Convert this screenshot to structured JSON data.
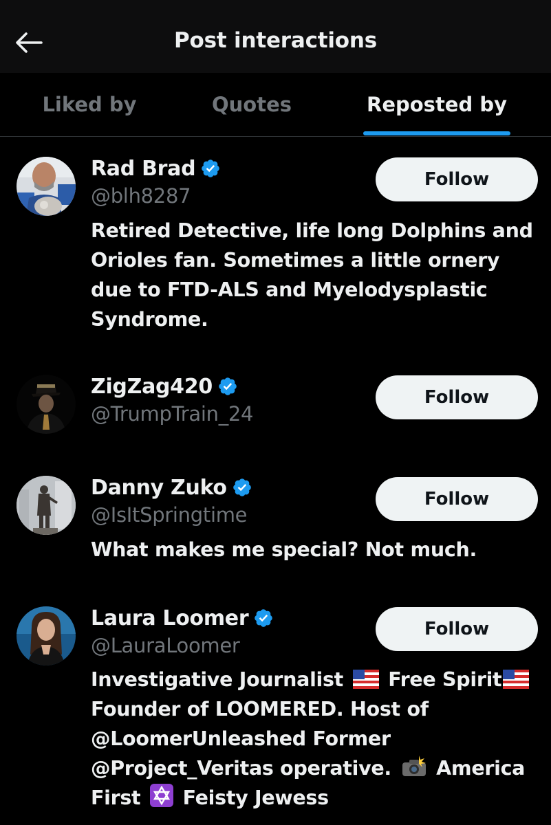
{
  "header": {
    "title": "Post interactions",
    "back_icon": "arrow-left-icon"
  },
  "tabs": [
    {
      "label": "Liked by",
      "active": false
    },
    {
      "label": "Quotes",
      "active": false
    },
    {
      "label": "Reposted by",
      "active": true
    }
  ],
  "colors": {
    "accent": "#1d9bf0",
    "background": "#000000",
    "secondary_text": "#71767b",
    "follow_button_bg": "#eff3f4"
  },
  "users": [
    {
      "name": "Rad Brad",
      "handle": "@blh8287",
      "verified": true,
      "follow_label": "Follow",
      "bio_lines": [
        "Retired Detective, life long Dolphins and",
        "Orioles fan. Sometimes a little ornery",
        "due to FTD-ALS and Myelodysplastic",
        "Syndrome."
      ]
    },
    {
      "name": "ZigZag420",
      "handle": "@TrumpTrain_24",
      "verified": true,
      "follow_label": "Follow",
      "bio_lines": []
    },
    {
      "name": "Danny Zuko",
      "handle": "@IsItSpringtime",
      "verified": true,
      "follow_label": "Follow",
      "bio_lines": [
        "What makes me special? Not much."
      ]
    },
    {
      "name": "Laura Loomer",
      "handle": "@LauraLoomer",
      "verified": true,
      "follow_label": "Follow",
      "bio": {
        "line1_a": "Investigative Journalist",
        "line1_b": "Free Spirit",
        "line2": "Founder of LOOMERED. Host of",
        "line3": "@LoomerUnleashed Former",
        "line4_a": "@Project_Veritas operative.",
        "line4_b": "America",
        "line5_a": "First",
        "line5_b": "Feisty Jewess"
      },
      "bio_emoji": [
        "us-flag-icon",
        "us-flag-icon",
        "camera-flash-icon",
        "star-of-david-icon"
      ]
    }
  ]
}
